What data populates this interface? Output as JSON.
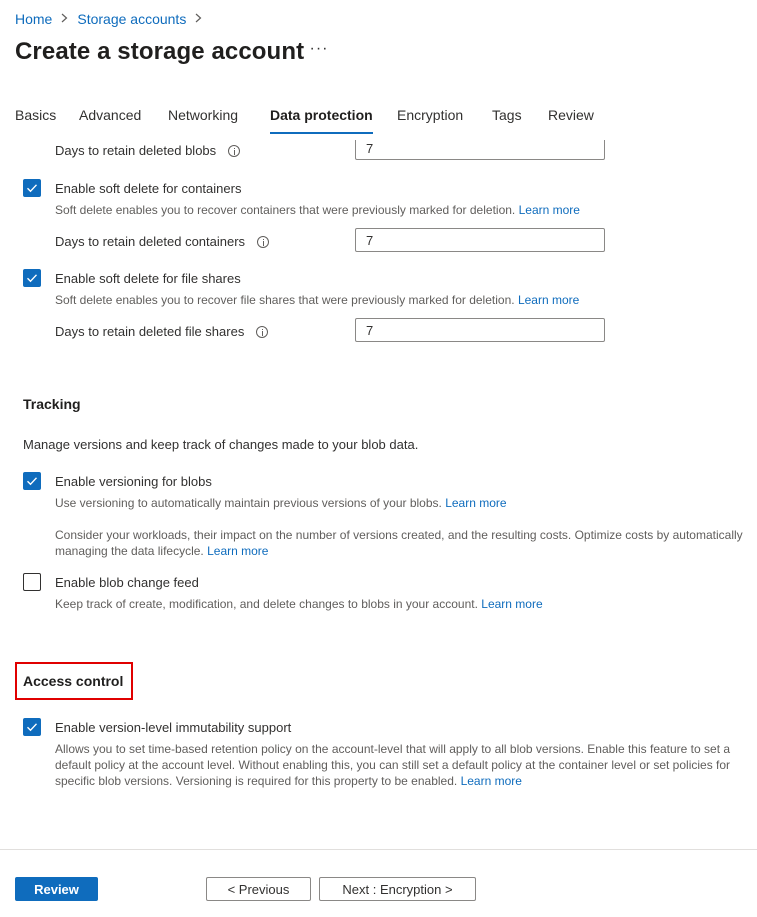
{
  "breadcrumb": {
    "items": [
      "Home",
      "Storage accounts"
    ]
  },
  "title": "Create a storage account",
  "more_label": "···",
  "tabs": [
    {
      "label": "Basics"
    },
    {
      "label": "Advanced"
    },
    {
      "label": "Networking"
    },
    {
      "label": "Data protection",
      "active": true
    },
    {
      "label": "Encryption"
    },
    {
      "label": "Tags"
    },
    {
      "label": "Review"
    }
  ],
  "recovery": {
    "clipped_label": "Days to retain deleted blobs",
    "containers": {
      "checkbox_label": "Enable soft delete for containers",
      "checked": true,
      "description": "Soft delete enables you to recover containers that were previously marked for deletion.",
      "learn_more": "Learn more",
      "days_label": "Days to retain deleted containers",
      "days_value": "7"
    },
    "file_shares": {
      "checkbox_label": "Enable soft delete for file shares",
      "checked": true,
      "description": "Soft delete enables you to recover file shares that were previously marked for deletion.",
      "learn_more": "Learn more",
      "days_label": "Days to retain deleted file shares",
      "days_value": "7"
    }
  },
  "tracking": {
    "title": "Tracking",
    "description": "Manage versions and keep track of changes made to your blob data.",
    "versioning": {
      "checkbox_label": "Enable versioning for blobs",
      "checked": true,
      "description": "Use versioning to automatically maintain previous versions of your blobs.",
      "learn_more": "Learn more",
      "note_line1": "Consider your workloads, their impact on the number of versions created, and the resulting costs. Optimize costs by automatically",
      "note_line2": "managing the data lifecycle.",
      "note_learn_more": "Learn more"
    },
    "change_feed": {
      "checkbox_label": "Enable blob change feed",
      "checked": false,
      "description": "Keep track of create, modification, and delete changes to blobs in your account.",
      "learn_more": "Learn more"
    }
  },
  "access_control": {
    "title": "Access control",
    "immutability": {
      "checkbox_label": "Enable version-level immutability support",
      "checked": true,
      "line1": "Allows you to set time-based retention policy on the account-level that will apply to all blob versions. Enable this feature to set a",
      "line2": "default policy at the account level. Without enabling this, you can still set a default policy at the container level or set policies for",
      "line3": "specific blob versions. Versioning is required for this property to be enabled.",
      "learn_more": "Learn more"
    }
  },
  "footer": {
    "review_label": "Review",
    "previous_label": "< Previous",
    "next_label": "Next : Encryption >"
  },
  "colors": {
    "accent": "#0f6cbd",
    "highlight": "#e00000"
  }
}
